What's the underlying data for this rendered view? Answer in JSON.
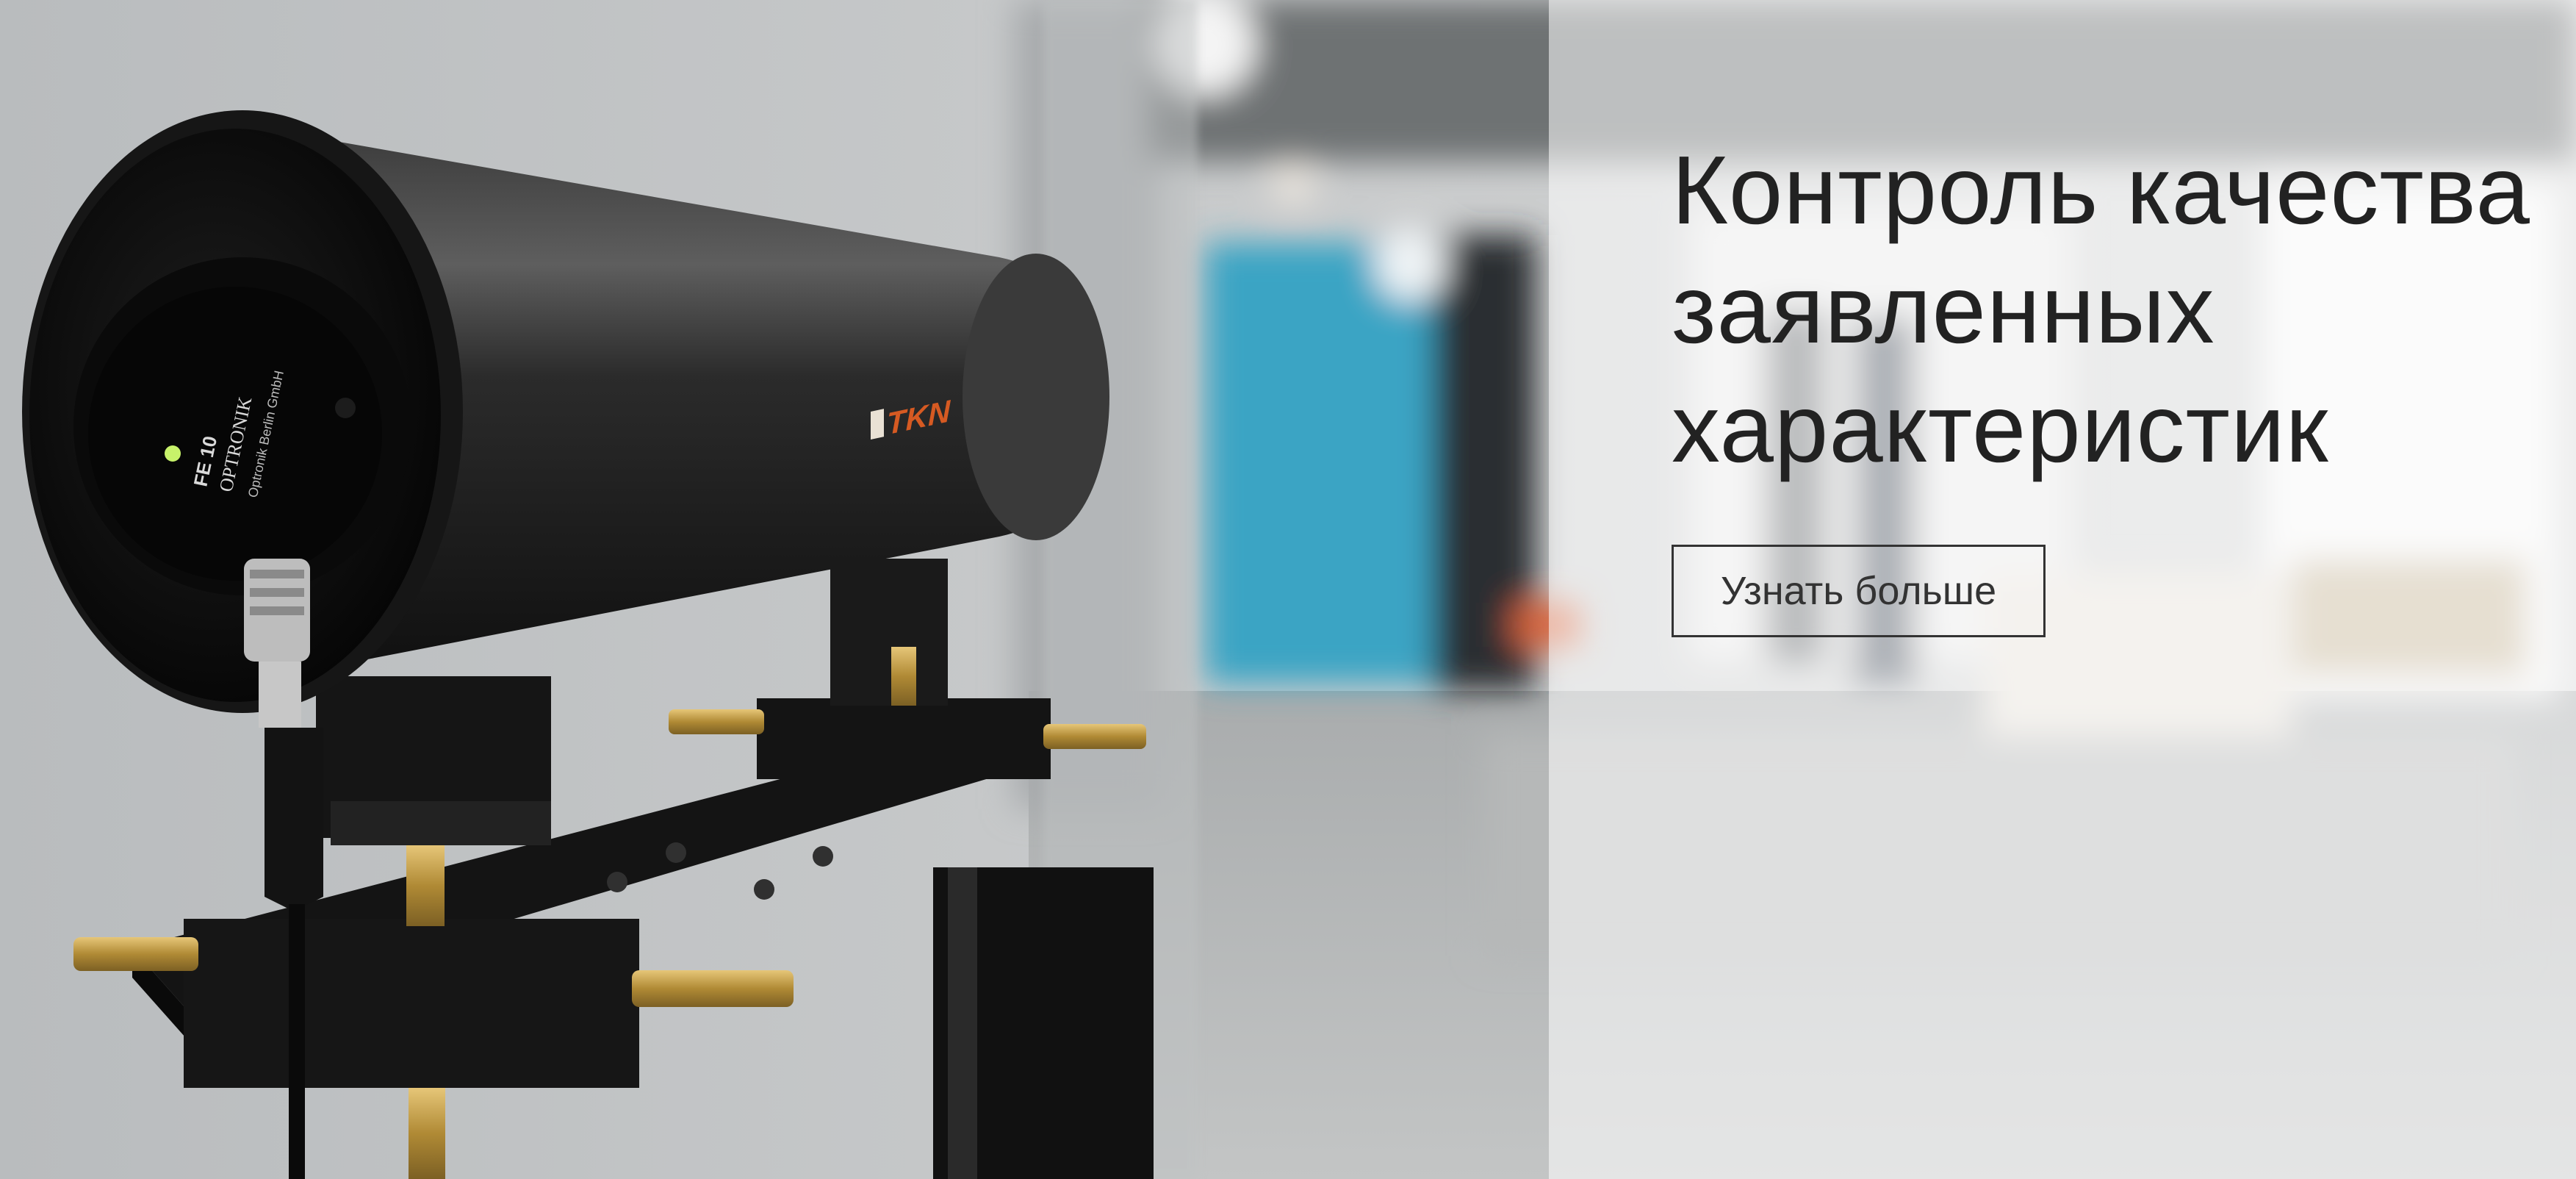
{
  "hero": {
    "title_lines": [
      "Контроль качества",
      "заявленных",
      "характеристик"
    ],
    "cta_label": "Узнать больше",
    "device": {
      "brand_mark": "TKN",
      "module_label_lines": [
        "FE 10",
        "OPTRONIK",
        "Optronik Berlin GmbH"
      ]
    }
  },
  "colors": {
    "overlay": "#ffffff",
    "title_text": "#222222",
    "button_border": "#333333",
    "cylinder": "#1a1a1a",
    "brass": "#c9a24a",
    "teal_cabinet": "#3aa4c4"
  },
  "icons": {
    "status_led": "led-indicator-icon"
  }
}
